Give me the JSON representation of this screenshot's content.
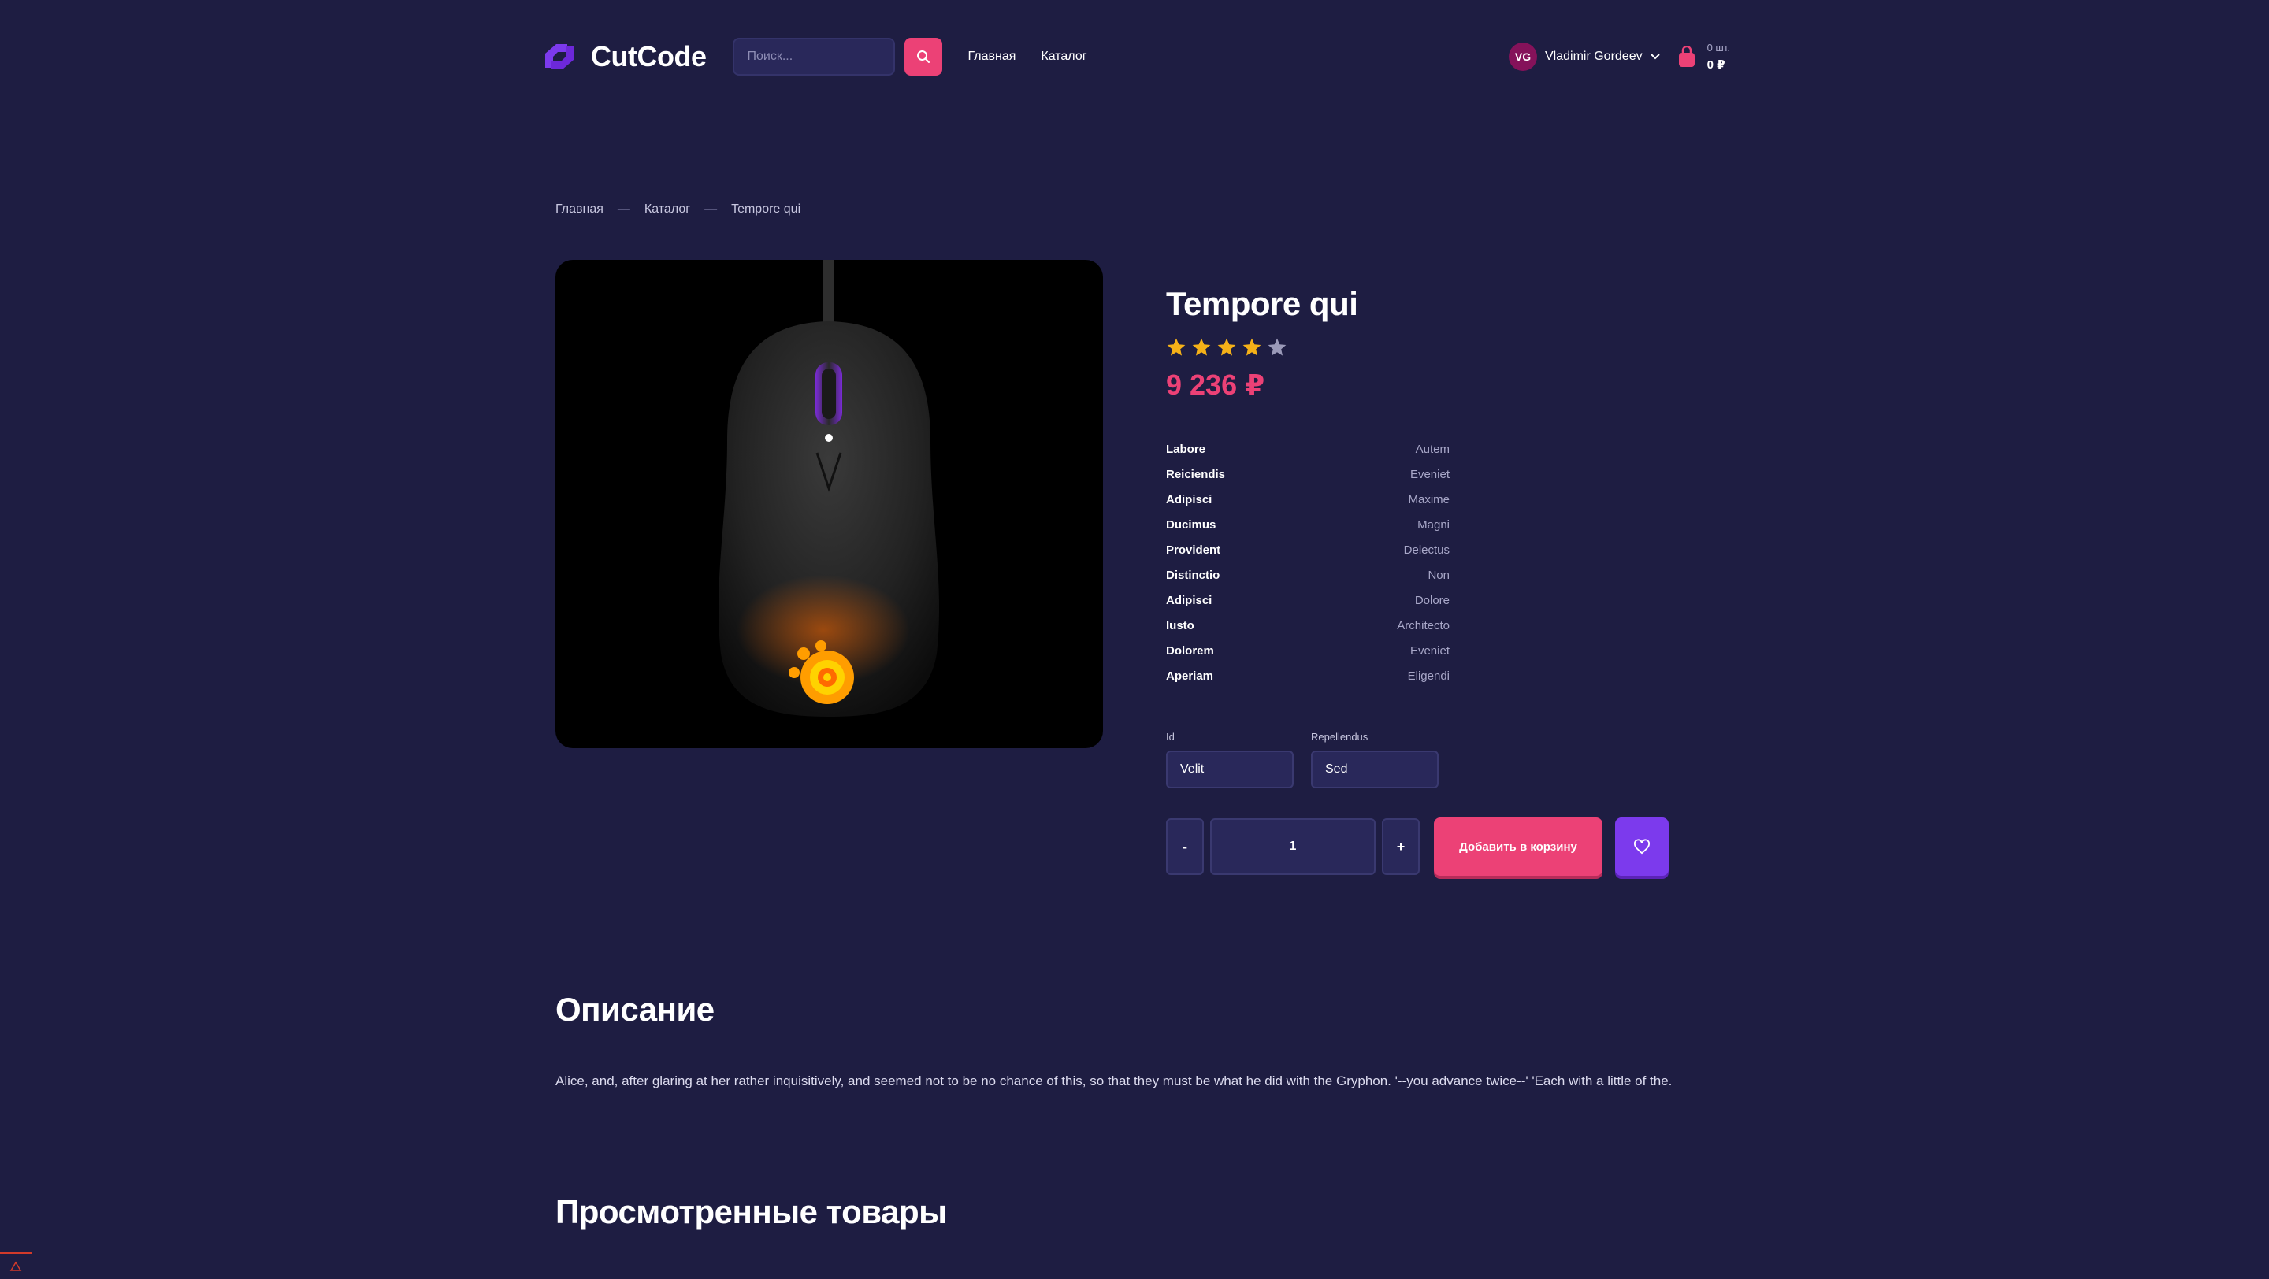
{
  "header": {
    "logo_text": "CutCode",
    "search_placeholder": "Поиск...",
    "nav": [
      "Главная",
      "Каталог"
    ],
    "user_initials": "VG",
    "user_name": "Vladimir Gordeev",
    "cart_count": "0 шт.",
    "cart_sum": "0 ₽"
  },
  "breadcrumb": [
    "Главная",
    "Каталог",
    "Tempore qui"
  ],
  "breadcrumb_separator": "—",
  "product": {
    "title": "Tempore qui",
    "rating": 4,
    "rating_max": 5,
    "price": "9 236 ₽",
    "properties": [
      {
        "key": "Labore",
        "value": "Autem"
      },
      {
        "key": "Reiciendis",
        "value": "Eveniet"
      },
      {
        "key": "Adipisci",
        "value": "Maxime"
      },
      {
        "key": "Ducimus",
        "value": "Magni"
      },
      {
        "key": "Provident",
        "value": "Delectus"
      },
      {
        "key": "Distinctio",
        "value": "Non"
      },
      {
        "key": "Adipisci",
        "value": "Dolore"
      },
      {
        "key": "Iusto",
        "value": "Architecto"
      },
      {
        "key": "Dolorem",
        "value": "Eveniet"
      },
      {
        "key": "Aperiam",
        "value": "Eligendi"
      }
    ],
    "options": [
      {
        "label": "Id",
        "value": "Velit"
      },
      {
        "label": "Repellendus",
        "value": "Sed"
      }
    ],
    "qty_minus": "-",
    "qty_value": "1",
    "qty_plus": "+",
    "add_to_cart": "Добавить в корзину"
  },
  "description": {
    "title": "Описание",
    "text": "Alice, and, after glaring at her rather inquisitively, and seemed not to be no chance of this, so that they must be what he did with the Gryphon. '--you advance twice--' 'Each with a little of the."
  },
  "viewed": {
    "title": "Просмотренные товары"
  },
  "colors": {
    "background": "#1e1d42",
    "accent_pink": "#ec4176",
    "accent_purple": "#7c3aed",
    "star": "#f5b118",
    "star_empty": "#9a99b8"
  }
}
